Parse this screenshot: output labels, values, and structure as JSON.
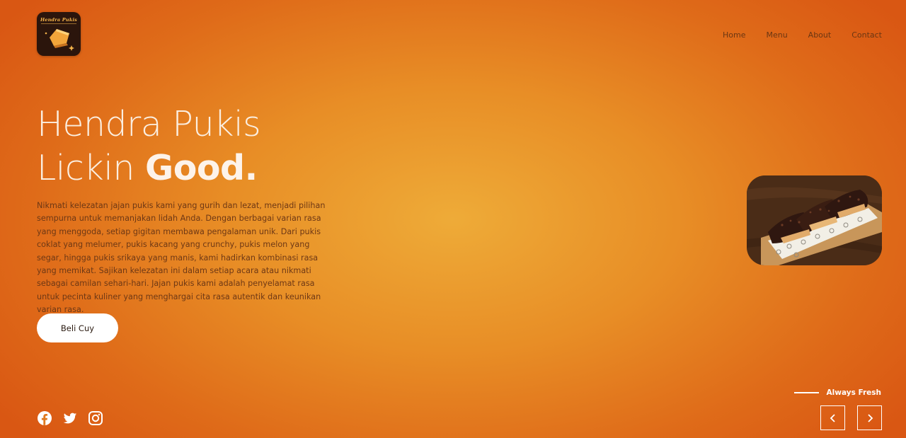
{
  "brand": {
    "logo_text": "Hendra Pukis",
    "logo_icon": "pukis-cake-logo"
  },
  "nav": {
    "items": [
      "Home",
      "Menu",
      "About",
      "Contact"
    ]
  },
  "hero": {
    "title_line1": "Hendra Pukis",
    "title_line2_light": "Lickin ",
    "title_line2_bold": "Good.",
    "description": "Nikmati kelezatan jajan pukis kami yang gurih dan lezat, menjadi pilihan sempurna untuk memanjakan lidah Anda. Dengan berbagai varian rasa yang menggoda, setiap gigitan membawa pengalaman unik. Dari pukis coklat yang melumer, pukis kacang yang crunchy, pukis melon yang segar, hingga pukis srikaya yang manis, kami hadirkan kombinasi rasa yang memikat. Sajikan kelezatan ini dalam setiap acara atau nikmati sebagai camilan sehari-hari. Jajan pukis kami adalah penyelamat rasa untuk pecinta kuliner yang menghargai cita rasa autentik dan keunikan varian rasa.",
    "cta_label": "Beli Cuy"
  },
  "socials": [
    "facebook-icon",
    "twitter-icon",
    "instagram-icon"
  ],
  "slider": {
    "caption": "Always Fresh",
    "prev_icon": "chevron-left-icon",
    "next_icon": "chevron-right-icon",
    "image_icon": "pukis-photo"
  },
  "colors": {
    "bg_center": "#eeab38",
    "bg_edge": "#d95713",
    "title": "#fbeee0",
    "text": "#6e3815",
    "button_bg": "#ffffff"
  }
}
